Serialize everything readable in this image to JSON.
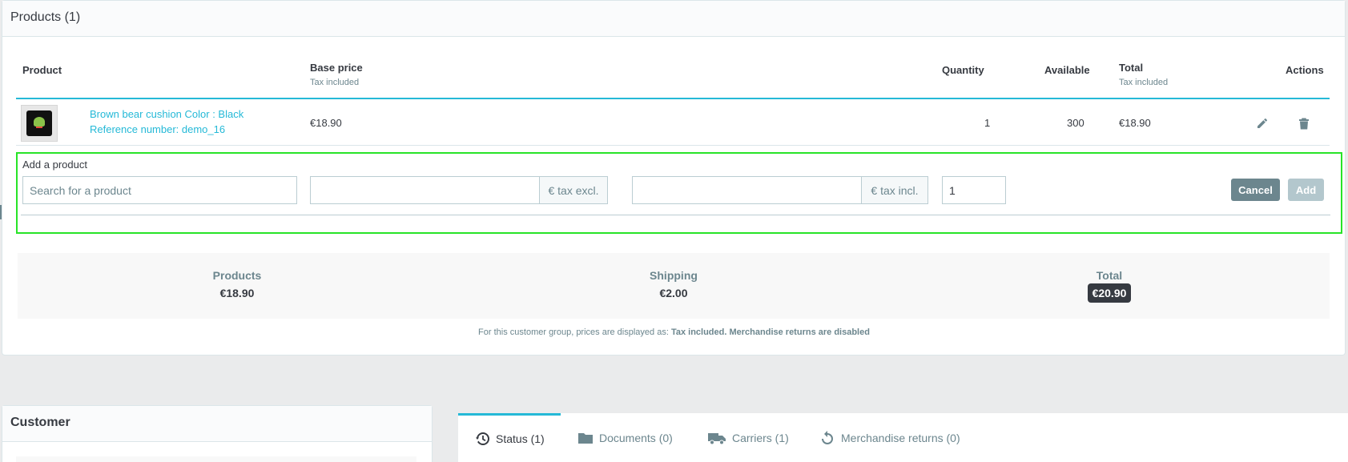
{
  "products_card": {
    "title": "Products (1)",
    "columns": {
      "product": "Product",
      "base_price": "Base price",
      "base_price_sub": "Tax included",
      "quantity": "Quantity",
      "available": "Available",
      "total": "Total",
      "total_sub": "Tax included",
      "actions": "Actions"
    },
    "rows": [
      {
        "name": "Brown bear cushion Color : Black",
        "reference": "Reference number: demo_16",
        "base_price": "€18.90",
        "quantity": "1",
        "available": "300",
        "total": "€18.90"
      }
    ]
  },
  "add_product": {
    "label": "Add a product",
    "search_placeholder": "Search for a product",
    "price_excl_value": "",
    "price_excl_addon": "€ tax excl.",
    "price_incl_value": "",
    "price_incl_addon": "€ tax incl.",
    "quantity_value": "1",
    "cancel_label": "Cancel",
    "add_label": "Add"
  },
  "summary": {
    "products_label": "Products",
    "products_value": "€18.90",
    "shipping_label": "Shipping",
    "shipping_value": "€2.00",
    "total_label": "Total",
    "total_value": "€20.90"
  },
  "note": {
    "prefix": "For this customer group, prices are displayed as: ",
    "tax_mode": "Tax included",
    "suffix": "Merchandise returns are disabled"
  },
  "customer_card": {
    "title": "Customer"
  },
  "tabs": [
    {
      "label": "Status (1)",
      "icon": "history-icon",
      "active": true
    },
    {
      "label": "Documents (0)",
      "icon": "folder-icon",
      "active": false
    },
    {
      "label": "Carriers (1)",
      "icon": "truck-icon",
      "active": false
    },
    {
      "label": "Merchandise returns (0)",
      "icon": "return-icon",
      "active": false
    }
  ],
  "colors": {
    "accent": "#25b9d7",
    "highlight_box": "#28e428",
    "text": "#363a41",
    "muted": "#6c868e"
  }
}
